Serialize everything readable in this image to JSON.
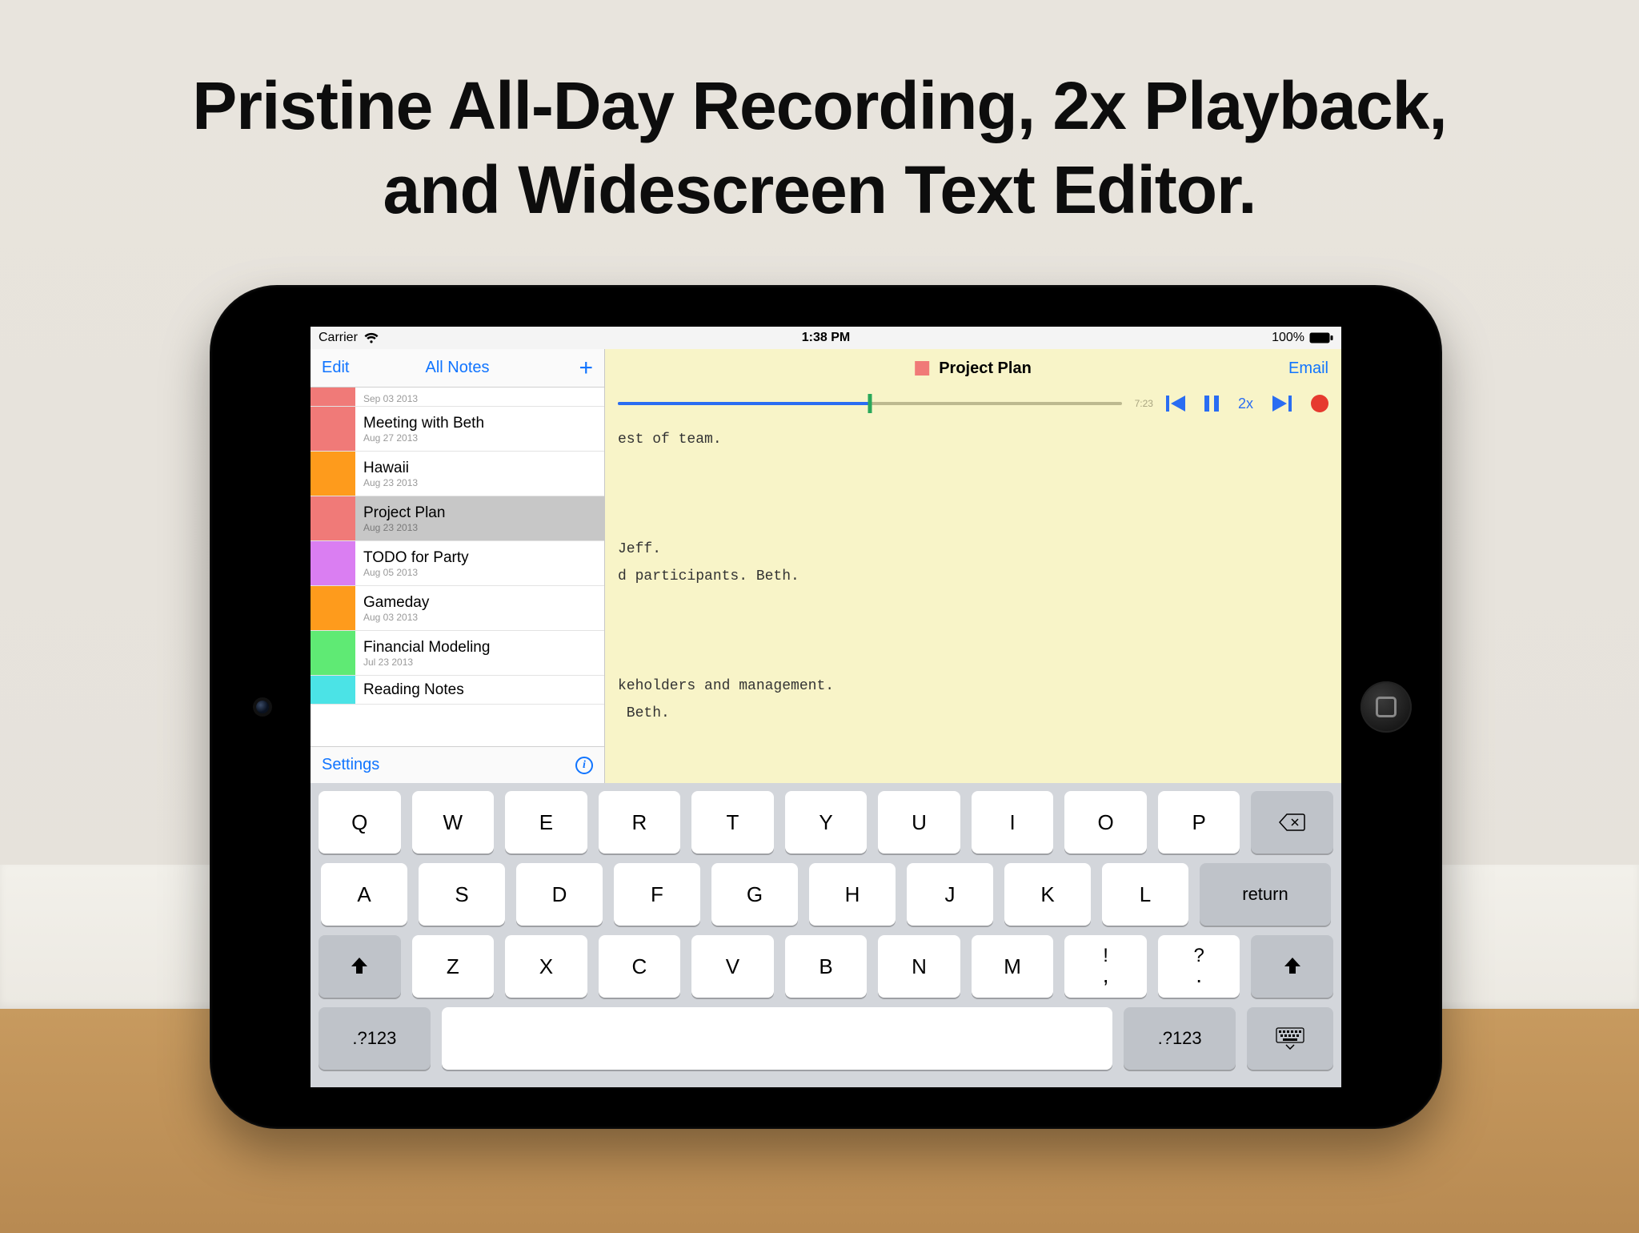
{
  "marketing": {
    "headline_l1": "Pristine All-Day Recording, 2x Playback,",
    "headline_l2": "and Widescreen Text Editor."
  },
  "statusbar": {
    "carrier": "Carrier",
    "time": "1:38 PM",
    "battery_text": "100%"
  },
  "sidebar": {
    "edit": "Edit",
    "title": "All Notes",
    "settings": "Settings",
    "notes": [
      {
        "title": "",
        "date": "Sep 03 2013",
        "color": "#f07a78",
        "partial": true
      },
      {
        "title": "Meeting with Beth",
        "date": "Aug 27 2013",
        "color": "#f07a78"
      },
      {
        "title": "Hawaii",
        "date": "Aug 23 2013",
        "color": "#fe9b1c"
      },
      {
        "title": "Project Plan",
        "date": "Aug 23 2013",
        "color": "#f07a78",
        "selected": true
      },
      {
        "title": "TODO for Party",
        "date": "Aug 05 2013",
        "color": "#da7ef2"
      },
      {
        "title": "Gameday",
        "date": "Aug 03 2013",
        "color": "#fe9b1c"
      },
      {
        "title": "Financial Modeling",
        "date": "Jul 23 2013",
        "color": "#5fea74"
      },
      {
        "title": "Reading Notes",
        "date": "",
        "color": "#4be3e6",
        "last": true
      }
    ]
  },
  "editor": {
    "title": "Project Plan",
    "title_color": "#f07a78",
    "email": "Email",
    "timestamp": "7:23",
    "speed": "2x",
    "progress_pct": 50,
    "body_lines": [
      "est of team.",
      "",
      "",
      "",
      "Jeff.",
      "d participants. Beth.",
      "",
      "",
      "",
      "keholders and management.",
      " Beth."
    ]
  },
  "keyboard": {
    "row1": [
      "Q",
      "W",
      "E",
      "R",
      "T",
      "Y",
      "U",
      "I",
      "O",
      "P"
    ],
    "row2": [
      "A",
      "S",
      "D",
      "F",
      "G",
      "H",
      "J",
      "K",
      "L"
    ],
    "row3": [
      "Z",
      "X",
      "C",
      "V",
      "B",
      "N",
      "M"
    ],
    "punct1_top": "!",
    "punct1_bot": ",",
    "punct2_top": "?",
    "punct2_bot": ".",
    "return": "return",
    "symbols": ".?123"
  }
}
